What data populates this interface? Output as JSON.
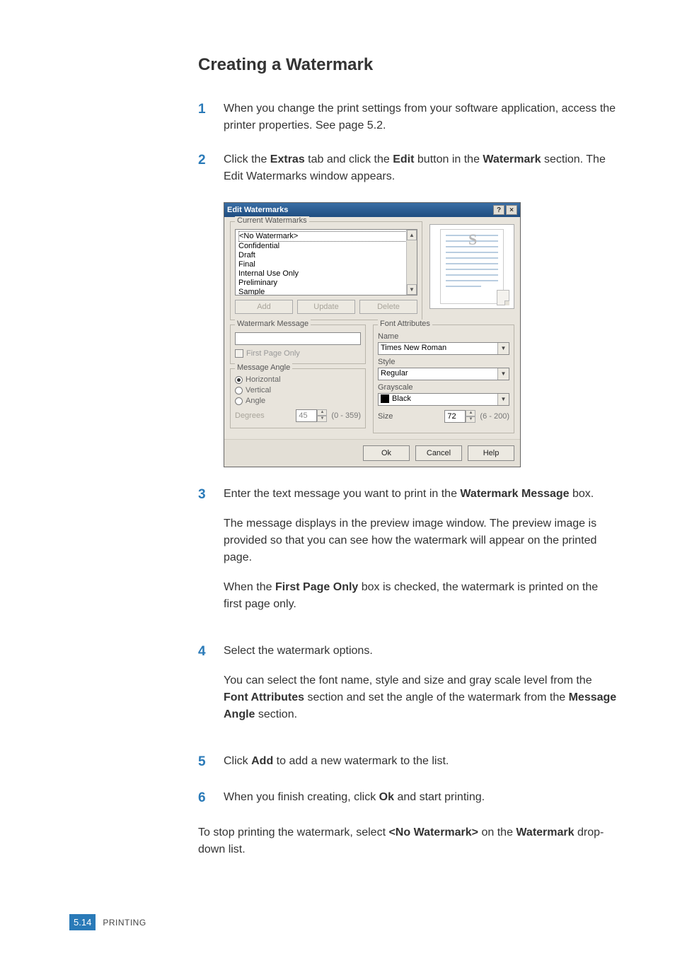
{
  "heading": "Creating a Watermark",
  "steps": {
    "s1": {
      "num": "1",
      "text": "When you change the print settings from your software application, access the printer properties. See page 5.2."
    },
    "s2": {
      "num": "2",
      "pre": "Click the ",
      "b1": "Extras",
      "mid1": " tab and click the ",
      "b2": "Edit",
      "mid2": " button in the ",
      "b3": "Watermark",
      "post": " section. The Edit Watermarks window appears."
    },
    "s3": {
      "num": "3",
      "p1a": "Enter the text message you want to print in the ",
      "p1b": "Watermark Message",
      "p1c": " box.",
      "p2": "The message displays in the preview image window. The preview image is provided so that you can see how the watermark will appear on the printed page.",
      "p3a": "When the ",
      "p3b": "First Page Only",
      "p3c": " box is checked, the watermark is printed on the first page only."
    },
    "s4": {
      "num": "4",
      "p1": "Select the watermark options.",
      "p2a": "You can select the font name, style and size and gray scale level from the ",
      "p2b": "Font Attributes",
      "p2c": " section and set the angle of the watermark from the ",
      "p2d": "Message Angle",
      "p2e": " section."
    },
    "s5": {
      "num": "5",
      "a": "Click ",
      "b": "Add",
      "c": " to add a new watermark to the list."
    },
    "s6": {
      "num": "6",
      "a": "When you finish creating, click ",
      "b": "Ok",
      "c": " and start printing."
    }
  },
  "closing": {
    "a": "To stop printing the watermark, select ",
    "b": "<No Watermark>",
    "c": " on the ",
    "d": "Watermark",
    "e": " drop-down list."
  },
  "dialog": {
    "title": "Edit Watermarks",
    "help_icon": "?",
    "close_icon": "×",
    "current_label": "Current Watermarks",
    "items": [
      "<No Watermark>",
      "Confidential",
      "Draft",
      "Final",
      "Internal Use Only",
      "Preliminary",
      "Sample"
    ],
    "btn_add": "Add",
    "btn_update": "Update",
    "btn_delete": "Delete",
    "preview_letter": "S",
    "msg_label": "Watermark Message",
    "first_page": "First Page Only",
    "angle_label": "Message Angle",
    "r_h": "Horizontal",
    "r_v": "Vertical",
    "r_a": "Angle",
    "degrees_label": "Degrees",
    "degrees_value": "45",
    "degrees_range": "(0 - 359)",
    "font_label": "Font Attributes",
    "name_label": "Name",
    "name_value": "Times New Roman",
    "style_label": "Style",
    "style_value": "Regular",
    "gray_label": "Grayscale",
    "gray_value": "Black",
    "size_label": "Size",
    "size_value": "72",
    "size_range": "(6 - 200)",
    "ok": "Ok",
    "cancel": "Cancel",
    "help": "Help"
  },
  "footer": {
    "chapter": "5.",
    "page": "14",
    "category": "PRINTING"
  }
}
